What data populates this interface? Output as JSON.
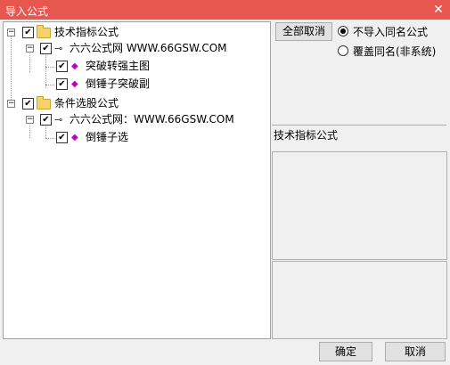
{
  "window": {
    "title": "导入公式",
    "close_glyph": "✕"
  },
  "tree": {
    "groups": [
      {
        "label": "技术指标公式",
        "source": {
          "label": "六六公式网 WWW.66GSW.COM",
          "children": [
            "突破转强主图",
            "倒锤子突破副"
          ]
        }
      },
      {
        "label": "条件选股公式",
        "source": {
          "label": "六六公式网：WWW.66GSW.COM",
          "children": [
            "倒锤子选"
          ]
        }
      }
    ]
  },
  "options": {
    "deselect_all_label": "全部取消",
    "radio_no_import": "不导入同名公式",
    "radio_overwrite": "覆盖同名(非系统)"
  },
  "info": {
    "type_label": "技术指标公式"
  },
  "footer": {
    "ok_label": "确定",
    "cancel_label": "取消"
  },
  "icons": {
    "expander_minus": "−",
    "check": "✔",
    "key": "⊸",
    "diamond": "◆"
  }
}
